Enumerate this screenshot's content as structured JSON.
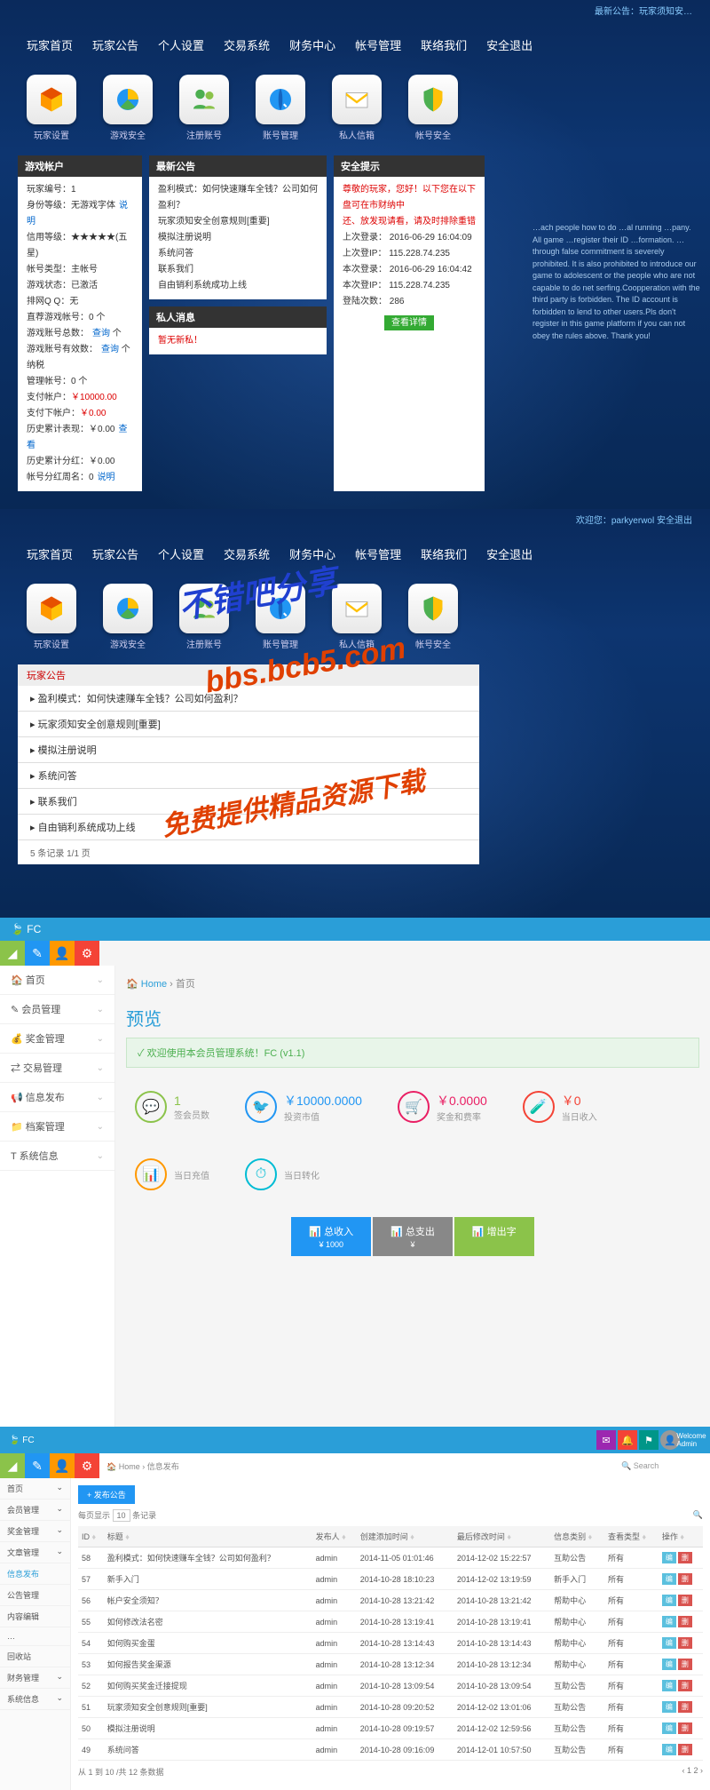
{
  "section1": {
    "top_status": "最新公告：玩家须知安…",
    "nav": [
      "玩家首页",
      "玩家公告",
      "个人设置",
      "交易系统",
      "财务中心",
      "帐号管理",
      "联络我们",
      "安全退出"
    ],
    "icons": [
      "玩家设置",
      "游戏安全",
      "注册账号",
      "账号管理",
      "私人信箱",
      "帐号安全"
    ],
    "account_panel": {
      "title": "游戏帐户",
      "rows": [
        {
          "k": "玩家编号：",
          "v": "1"
        },
        {
          "k": "身份等级：",
          "v": "无游戏字体",
          "link": "说明"
        },
        {
          "k": "信用等级：",
          "v": "★★★★★(五星)"
        },
        {
          "k": "帐号类型：",
          "v": "主帐号"
        },
        {
          "k": "游戏状态：",
          "v": "已激活"
        },
        {
          "k": "排网Q Q：",
          "v": "无"
        },
        {
          "k": "直荐游戏帐号：",
          "v": "0 个"
        },
        {
          "k": "游戏账号总数：",
          "v": "",
          "link": "查询",
          "suffix": "个"
        },
        {
          "k": "游戏账号有效数：",
          "v": "",
          "link": "查询",
          "suffix": "个纳税"
        },
        {
          "k": "管理帐号：",
          "v": "0 个"
        },
        {
          "k": "支付帐户：",
          "v": "￥10000.00",
          "cls": "red"
        },
        {
          "k": "支付下帐户：",
          "v": "￥0.00",
          "cls": "red"
        },
        {
          "k": "历史累计表现：",
          "v": "￥0.00",
          "link": "查看"
        },
        {
          "k": "历史累计分红：",
          "v": "￥0.00"
        },
        {
          "k": "帐号分红周名：",
          "v": "0",
          "link": "说明"
        }
      ]
    },
    "notice_panel": {
      "title": "最新公告",
      "items": [
        "盈利模式：如何快速赚车全钱？公司如何盈利？",
        "玩家须知安全创意规则[重要]",
        "模拟注册说明",
        "系统问答",
        "联系我们",
        "自由销利系统成功上线"
      ]
    },
    "msg_panel": {
      "title": "私人消息",
      "text": "暂无新私！"
    },
    "safety_panel": {
      "title": "安全提示",
      "warn1": "尊敬的玩家，您好！以下您在以下盘可在市财纳中",
      "warn2": "还、放发现请看，请及时排除重错",
      "rows": [
        {
          "k": "上次登录：",
          "v": "2016-06-29 16:04:09"
        },
        {
          "k": "上次登IP：",
          "v": "115.228.74.235"
        },
        {
          "k": "本次登录：",
          "v": "2016-06-29 16:04:42"
        },
        {
          "k": "本次登IP：",
          "v": "115.228.74.235"
        },
        {
          "k": "登陆次数：",
          "v": "286"
        }
      ],
      "btn": "查看详情"
    },
    "rules_text": "…ach people how to do …al running …pany. All game …register their ID …formation. … through false commitment is severely prohibited. It is also prohibited to introduce our game to adolescent or the people who are not capable to do net serfing.Coopperation with the third party is forbidden. The ID account is forbidden to lend to other users.Pls don't register in this game platform if you can not obey the rules above. Thank you!"
  },
  "section2": {
    "top_right": "欢迎您：parkyerwol 安全退出",
    "announce_title": "玩家公告",
    "announce_items": [
      "盈利模式：如何快速赚车全钱？公司如何盈利？",
      "玩家须知安全创意规则[重要]",
      "模拟注册说明",
      "系统问答",
      "联系我们",
      "自由销利系统成功上线"
    ],
    "announce_foot": "5 条记录 1/1 页"
  },
  "watermarks": {
    "wm1": "不错吧分享",
    "wm2": "bbs.bcb5.com",
    "wm3": "免费提供精品资源下载"
  },
  "section3": {
    "brand": "FC",
    "crumb_home": "Home",
    "crumb_page": "首页",
    "title": "预览",
    "welcome": "✓ 欢迎使用本会员管理系统！FC (v1.1)",
    "sidebar": [
      "首页",
      "会员管理",
      "奖金管理",
      "交易管理",
      "信息发布",
      "档案管理",
      "系统信息"
    ],
    "stats": [
      {
        "icon": "💬",
        "cls": "si-green",
        "val": "1",
        "lbl": "签会员数"
      },
      {
        "icon": "🐦",
        "cls": "si-blue",
        "val": "￥10000.0000",
        "lbl": "投资市值"
      },
      {
        "icon": "🛒",
        "cls": "si-pink",
        "val": "￥0.0000",
        "lbl": "奖金和费率"
      },
      {
        "icon": "🧪",
        "cls": "si-red",
        "val": "￥0",
        "lbl": "当日收入"
      },
      {
        "icon": "📊",
        "cls": "si-orange",
        "val": "",
        "lbl": "当日充值"
      },
      {
        "icon": "⏱",
        "cls": "si-teal",
        "val": "",
        "lbl": "当日转化"
      }
    ],
    "actions": [
      {
        "cls": "ab-blue",
        "t": "总收入",
        "s": "¥ 1000"
      },
      {
        "cls": "ab-gray",
        "t": "总支出",
        "s": "¥"
      },
      {
        "cls": "ab-green",
        "t": "增出字",
        "s": ""
      }
    ]
  },
  "section4": {
    "brand": "FC",
    "crumb": "Home › 信息发布",
    "search_placeholder": "🔍 Search",
    "add_btn": "+ 发布公告",
    "sidebar": [
      "首页",
      "会员管理",
      "奖金管理",
      "文章管理",
      "信息发布",
      "公告管理",
      "内容编辑",
      "…",
      "回收站",
      "财务管理",
      "系统信息"
    ],
    "per_page_label": "每页显示",
    "per_page": "10",
    "per_page_suffix": "条记录",
    "cols": [
      "ID",
      "标题",
      "发布人",
      "创建添加时间",
      "最后修改时间",
      "信息类别",
      "查看类型",
      "操作"
    ],
    "rows": [
      {
        "id": "58",
        "title": "盈利模式：如何快速赚车全钱？公司如何盈利？",
        "author": "admin",
        "created": "2014-11-05 01:01:46",
        "modified": "2014-12-02 15:22:57",
        "cat": "互助公告",
        "type": "所有"
      },
      {
        "id": "57",
        "title": "新手入门",
        "author": "admin",
        "created": "2014-10-28 18:10:23",
        "modified": "2014-12-02 13:19:59",
        "cat": "新手入门",
        "type": "所有"
      },
      {
        "id": "56",
        "title": "帐户安全须知？",
        "author": "admin",
        "created": "2014-10-28 13:21:42",
        "modified": "2014-10-28 13:21:42",
        "cat": "帮助中心",
        "type": "所有"
      },
      {
        "id": "55",
        "title": "如何修改法名密",
        "author": "admin",
        "created": "2014-10-28 13:19:41",
        "modified": "2014-10-28 13:19:41",
        "cat": "帮助中心",
        "type": "所有"
      },
      {
        "id": "54",
        "title": "如何购买金蛋",
        "author": "admin",
        "created": "2014-10-28 13:14:43",
        "modified": "2014-10-28 13:14:43",
        "cat": "帮助中心",
        "type": "所有"
      },
      {
        "id": "53",
        "title": "如何报告奖金渠源",
        "author": "admin",
        "created": "2014-10-28 13:12:34",
        "modified": "2014-10-28 13:12:34",
        "cat": "帮助中心",
        "type": "所有"
      },
      {
        "id": "52",
        "title": "如何购买奖金迁接提现",
        "author": "admin",
        "created": "2014-10-28 13:09:54",
        "modified": "2014-10-28 13:09:54",
        "cat": "互助公告",
        "type": "所有"
      },
      {
        "id": "51",
        "title": "玩家须知安全创意规则[重要]",
        "author": "admin",
        "created": "2014-10-28 09:20:52",
        "modified": "2014-12-02 13:01:06",
        "cat": "互助公告",
        "type": "所有"
      },
      {
        "id": "50",
        "title": "模拟注册说明",
        "author": "admin",
        "created": "2014-10-28 09:19:57",
        "modified": "2014-12-02 12:59:56",
        "cat": "互助公告",
        "type": "所有"
      },
      {
        "id": "49",
        "title": "系统问答",
        "author": "admin",
        "created": "2014-10-28 09:16:09",
        "modified": "2014-12-01 10:57:50",
        "cat": "互助公告",
        "type": "所有"
      }
    ],
    "footer": "从 1 到 10 /共 12 条数据",
    "op_edit": "编",
    "op_del": "删"
  }
}
